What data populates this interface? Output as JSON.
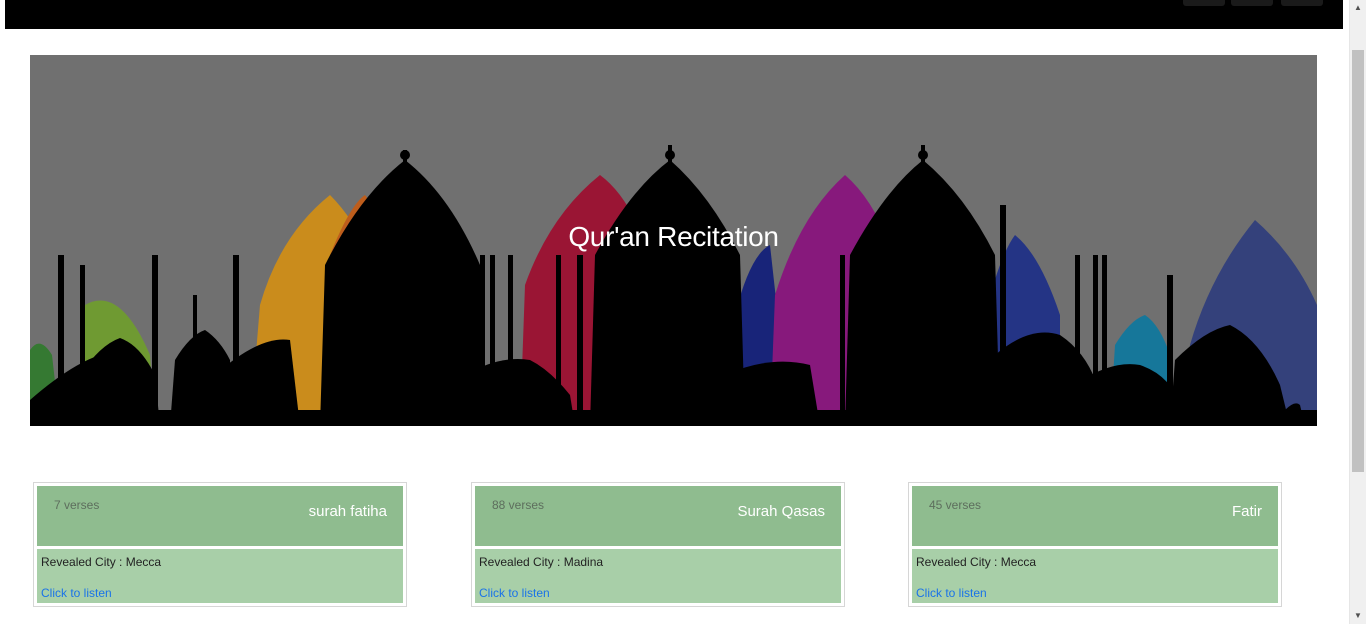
{
  "hero": {
    "title": "Qur'an Recitation"
  },
  "cards": [
    {
      "verses": "7 verses",
      "name": "surah fatiha",
      "city": "Revealed City : Mecca",
      "listen": "Click to listen"
    },
    {
      "verses": "88 verses",
      "name": "Surah Qasas",
      "city": "Revealed City : Madina",
      "listen": "Click to listen"
    },
    {
      "verses": "45 verses",
      "name": "Fatir",
      "city": "Revealed City : Mecca",
      "listen": "Click to listen"
    }
  ],
  "colors": {
    "topbar": "#000000",
    "card_head": "#8fbc8f",
    "card_body": "#a8cfa8",
    "link": "#1a73e8"
  },
  "icons": {
    "scroll_up": "arrow-up-icon",
    "scroll_down": "arrow-down-icon"
  }
}
